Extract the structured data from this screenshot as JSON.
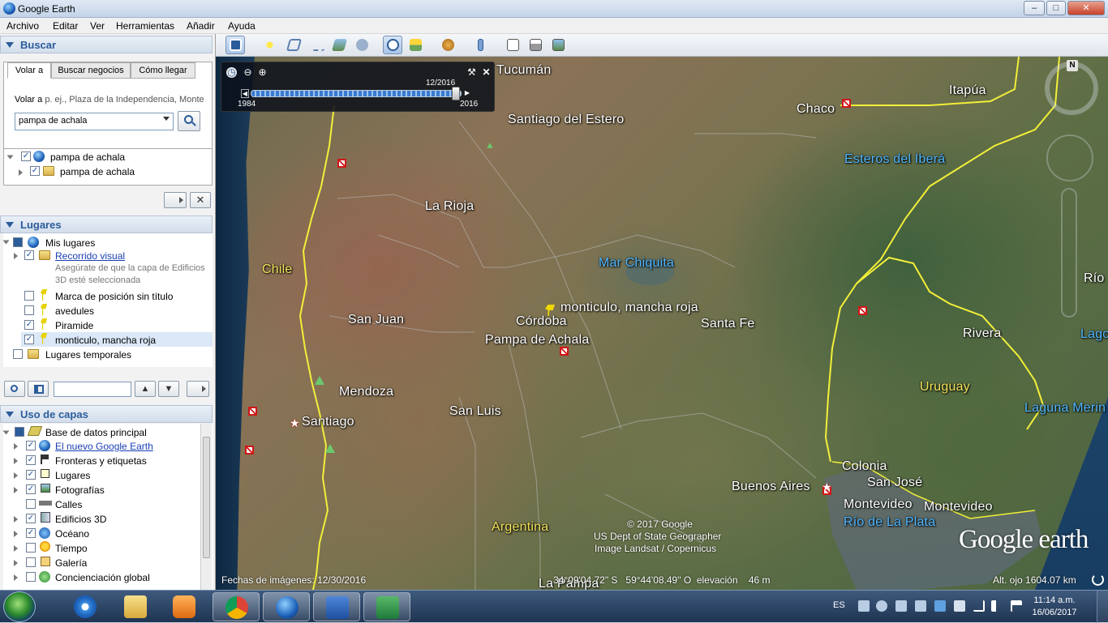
{
  "window": {
    "title": "Google Earth"
  },
  "menu": [
    "Archivo",
    "Editar",
    "Ver",
    "Herramientas",
    "Añadir",
    "Ayuda"
  ],
  "search": {
    "header": "Buscar",
    "tabs": [
      "Volar a",
      "Buscar negocios",
      "Cómo llegar"
    ],
    "fly_label": "Volar a",
    "fly_hint": "p. ej., Plaza de la Independencia, Monte",
    "value": "pampa de achala",
    "results": [
      {
        "label": "pampa de achala",
        "checked": true
      },
      {
        "label": "pampa de achala",
        "checked": true
      }
    ]
  },
  "places": {
    "header": "Lugares",
    "items": [
      {
        "label": "Mis lugares",
        "checked": true
      },
      {
        "label": "Recorrido visual",
        "checked": true
      },
      {
        "label": "Asegúrate de que la capa de Edificios",
        "checked": false
      },
      {
        "label": "3D esté seleccionada",
        "checked": false
      },
      {
        "label": "Marca de posición sin título",
        "checked": false
      },
      {
        "label": "avedules",
        "checked": false
      },
      {
        "label": "Piramide",
        "checked": true
      },
      {
        "label": "monticulo, mancha roja",
        "checked": true
      },
      {
        "label": "Lugares temporales",
        "checked": false
      }
    ]
  },
  "layers": {
    "header": "Uso de capas",
    "items": [
      {
        "label": "Base de datos principal",
        "checked": true
      },
      {
        "label": "El nuevo Google Earth",
        "checked": true
      },
      {
        "label": "Fronteras y etiquetas",
        "checked": true
      },
      {
        "label": "Lugares",
        "checked": true
      },
      {
        "label": "Fotografías",
        "checked": true
      },
      {
        "label": "Calles",
        "checked": false
      },
      {
        "label": "Edificios 3D",
        "checked": true
      },
      {
        "label": "Océano",
        "checked": true
      },
      {
        "label": "Tiempo",
        "checked": false
      },
      {
        "label": "Galería",
        "checked": false
      },
      {
        "label": "Concienciación global",
        "checked": false
      }
    ]
  },
  "time_slider": {
    "current": "12/2016",
    "start": "1984",
    "end": "2016",
    "position": 0.97
  },
  "map_labels": {
    "tucuman": "Tucumán",
    "santiago_estero": "Santiago del Estero",
    "chaco": "Chaco",
    "itapua": "Itapúa",
    "esteros": "Esteros del Iberá",
    "la_rioja": "La Rioja",
    "chile": "Chile",
    "mar_chiquita": "Mar Chiquita",
    "monticulo": "monticulo, mancha roja",
    "cordoba": "Córdoba",
    "pampa": "Pampa de Achala",
    "santa_fe": "Santa Fe",
    "san_juan": "San Juan",
    "rivera": "Rivera",
    "uruguay": "Uruguay",
    "mendoza": "Mendoza",
    "santiago": "Santiago",
    "san_luis": "San Luis",
    "laguna": "Laguna Merin",
    "rio": "Río",
    "lago": "Lago",
    "colonia": "Colonia",
    "san_jose": "San José",
    "buenos_aires": "Buenos Aires",
    "montevideo1": "Montevideo",
    "montevideo2": "Montevideo",
    "rio_plata": "Río de La Plata",
    "argentina": "Argentina",
    "la_pampa": "La Pampa"
  },
  "copyright": [
    "© 2017 Google",
    "US Dept of State Geographer",
    "Image Landsat / Copernicus"
  ],
  "logo": "Google earth",
  "status": {
    "imagery_date": "Fechas de imágenes: 12/30/2016",
    "coords": "34°09'04.72\" S   59°44'08.49\" O  elevación    46 m",
    "eye_alt": "Alt. ojo  1604.07 km"
  },
  "taskbar": {
    "lang": "ES",
    "time": "11:14 a.m.",
    "date": "16/06/2017",
    "apps": [
      "internet-explorer",
      "file-explorer",
      "media-player",
      "chrome",
      "google-earth",
      "word",
      "excel"
    ]
  },
  "colors": {
    "border_yellow": "#f2ef3a",
    "accent": "#2b5c9a",
    "marker_red": "#d01818"
  }
}
